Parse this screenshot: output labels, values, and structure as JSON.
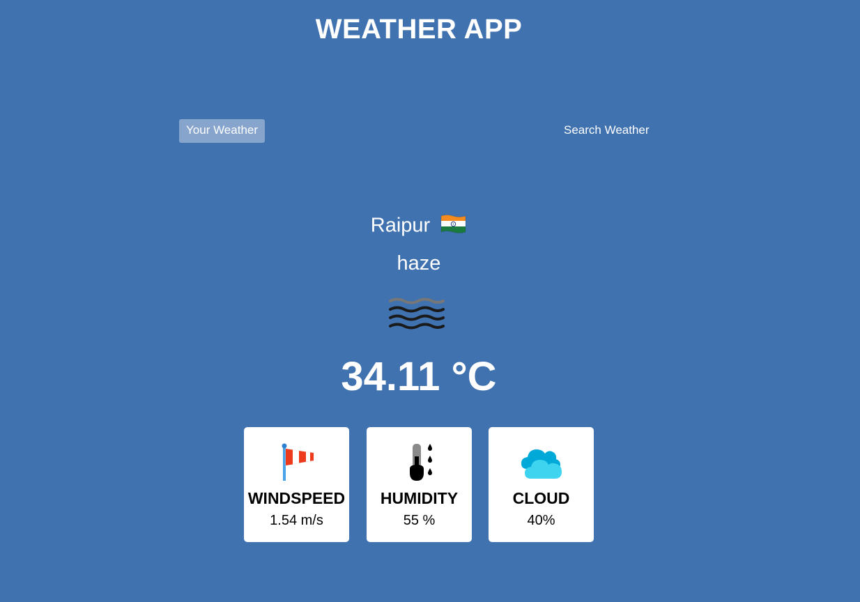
{
  "app": {
    "title": "WEATHER APP"
  },
  "tabs": {
    "your_weather": "Your Weather",
    "search_weather": "Search Weather",
    "active": "your_weather"
  },
  "weather": {
    "city": "Raipur",
    "country_flag_icon": "india-flag-icon",
    "condition": "haze",
    "condition_icon": "haze-icon",
    "temperature": "34.11 °C"
  },
  "cards": {
    "windspeed": {
      "icon": "windsock-icon",
      "label": "WINDSPEED",
      "value": "1.54 m/s"
    },
    "humidity": {
      "icon": "humidity-icon",
      "label": "HUMIDITY",
      "value": "55 %"
    },
    "cloud": {
      "icon": "cloud-icon",
      "label": "CLOUD",
      "value": "40%"
    }
  },
  "colors": {
    "background": "#4072b0",
    "active_tab": "#dbe2ef",
    "card_background": "#ffffff"
  }
}
